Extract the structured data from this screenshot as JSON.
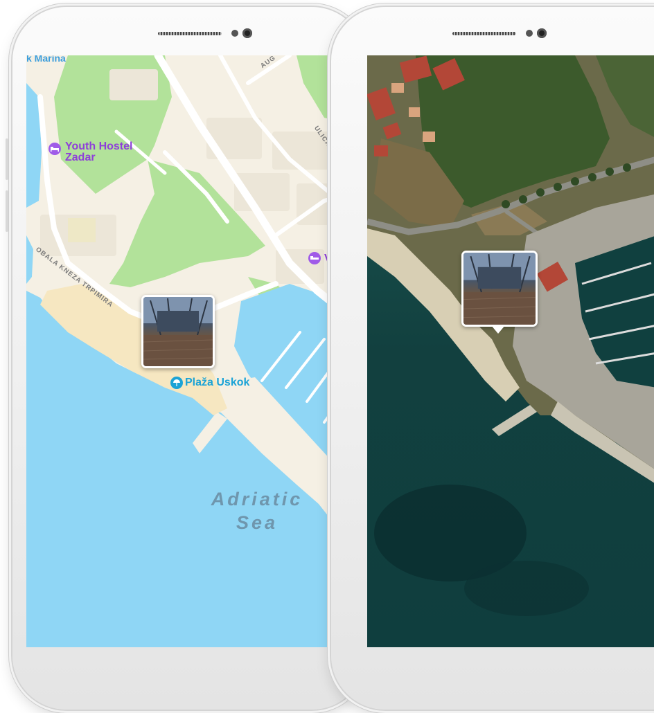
{
  "map_view": {
    "labels": {
      "marina_partial": "k Marina",
      "hostel_line1": "Youth Hostel",
      "hostel_line2": "Zadar",
      "villa_partial": "Villa",
      "street_obala": "OBALA KNEZA TRPIMIRA",
      "street_ulica": "ULICA MA",
      "street_aug": "AUG",
      "beach": "Plaža Uskok",
      "sea_line1": "Adriatic",
      "sea_line2": "Sea"
    }
  },
  "satellite_view": {},
  "colors": {
    "water": "#8fd6f5",
    "land": "#f5f0e4",
    "park": "#b2e29a",
    "poi_purple": "#8e3fd9",
    "poi_blue": "#1ba3d6",
    "sat_sea": "#0f3e3e"
  },
  "icons": {
    "hostel": "bed-icon",
    "beach": "beach-umbrella-icon",
    "villa": "bed-icon",
    "photo_marker": "photo-thumbnail-icon"
  }
}
